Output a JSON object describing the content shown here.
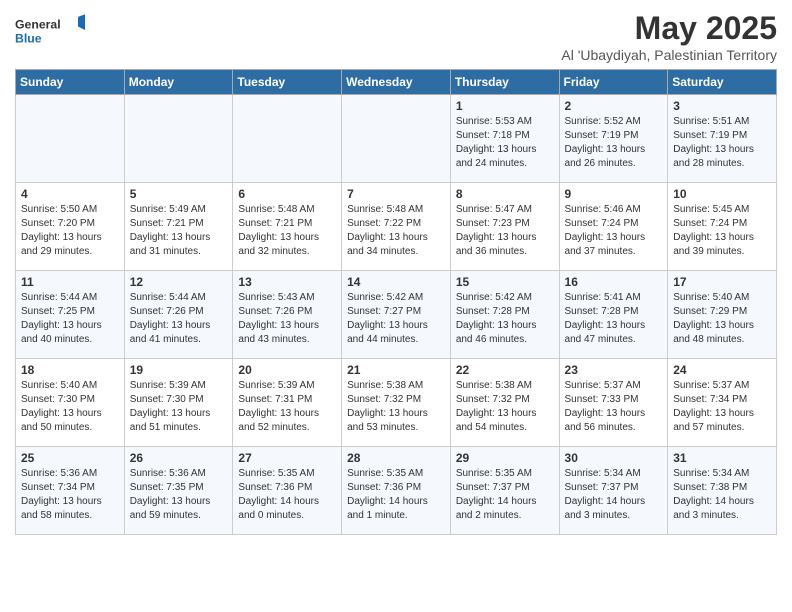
{
  "logo": {
    "text_general": "General",
    "text_blue": "Blue"
  },
  "title": "May 2025",
  "subtitle": "Al 'Ubaydiyah, Palestinian Territory",
  "weekdays": [
    "Sunday",
    "Monday",
    "Tuesday",
    "Wednesday",
    "Thursday",
    "Friday",
    "Saturday"
  ],
  "weeks": [
    [
      {
        "day": "",
        "info": ""
      },
      {
        "day": "",
        "info": ""
      },
      {
        "day": "",
        "info": ""
      },
      {
        "day": "",
        "info": ""
      },
      {
        "day": "1",
        "info": "Sunrise: 5:53 AM\nSunset: 7:18 PM\nDaylight: 13 hours\nand 24 minutes."
      },
      {
        "day": "2",
        "info": "Sunrise: 5:52 AM\nSunset: 7:19 PM\nDaylight: 13 hours\nand 26 minutes."
      },
      {
        "day": "3",
        "info": "Sunrise: 5:51 AM\nSunset: 7:19 PM\nDaylight: 13 hours\nand 28 minutes."
      }
    ],
    [
      {
        "day": "4",
        "info": "Sunrise: 5:50 AM\nSunset: 7:20 PM\nDaylight: 13 hours\nand 29 minutes."
      },
      {
        "day": "5",
        "info": "Sunrise: 5:49 AM\nSunset: 7:21 PM\nDaylight: 13 hours\nand 31 minutes."
      },
      {
        "day": "6",
        "info": "Sunrise: 5:48 AM\nSunset: 7:21 PM\nDaylight: 13 hours\nand 32 minutes."
      },
      {
        "day": "7",
        "info": "Sunrise: 5:48 AM\nSunset: 7:22 PM\nDaylight: 13 hours\nand 34 minutes."
      },
      {
        "day": "8",
        "info": "Sunrise: 5:47 AM\nSunset: 7:23 PM\nDaylight: 13 hours\nand 36 minutes."
      },
      {
        "day": "9",
        "info": "Sunrise: 5:46 AM\nSunset: 7:24 PM\nDaylight: 13 hours\nand 37 minutes."
      },
      {
        "day": "10",
        "info": "Sunrise: 5:45 AM\nSunset: 7:24 PM\nDaylight: 13 hours\nand 39 minutes."
      }
    ],
    [
      {
        "day": "11",
        "info": "Sunrise: 5:44 AM\nSunset: 7:25 PM\nDaylight: 13 hours\nand 40 minutes."
      },
      {
        "day": "12",
        "info": "Sunrise: 5:44 AM\nSunset: 7:26 PM\nDaylight: 13 hours\nand 41 minutes."
      },
      {
        "day": "13",
        "info": "Sunrise: 5:43 AM\nSunset: 7:26 PM\nDaylight: 13 hours\nand 43 minutes."
      },
      {
        "day": "14",
        "info": "Sunrise: 5:42 AM\nSunset: 7:27 PM\nDaylight: 13 hours\nand 44 minutes."
      },
      {
        "day": "15",
        "info": "Sunrise: 5:42 AM\nSunset: 7:28 PM\nDaylight: 13 hours\nand 46 minutes."
      },
      {
        "day": "16",
        "info": "Sunrise: 5:41 AM\nSunset: 7:28 PM\nDaylight: 13 hours\nand 47 minutes."
      },
      {
        "day": "17",
        "info": "Sunrise: 5:40 AM\nSunset: 7:29 PM\nDaylight: 13 hours\nand 48 minutes."
      }
    ],
    [
      {
        "day": "18",
        "info": "Sunrise: 5:40 AM\nSunset: 7:30 PM\nDaylight: 13 hours\nand 50 minutes."
      },
      {
        "day": "19",
        "info": "Sunrise: 5:39 AM\nSunset: 7:30 PM\nDaylight: 13 hours\nand 51 minutes."
      },
      {
        "day": "20",
        "info": "Sunrise: 5:39 AM\nSunset: 7:31 PM\nDaylight: 13 hours\nand 52 minutes."
      },
      {
        "day": "21",
        "info": "Sunrise: 5:38 AM\nSunset: 7:32 PM\nDaylight: 13 hours\nand 53 minutes."
      },
      {
        "day": "22",
        "info": "Sunrise: 5:38 AM\nSunset: 7:32 PM\nDaylight: 13 hours\nand 54 minutes."
      },
      {
        "day": "23",
        "info": "Sunrise: 5:37 AM\nSunset: 7:33 PM\nDaylight: 13 hours\nand 56 minutes."
      },
      {
        "day": "24",
        "info": "Sunrise: 5:37 AM\nSunset: 7:34 PM\nDaylight: 13 hours\nand 57 minutes."
      }
    ],
    [
      {
        "day": "25",
        "info": "Sunrise: 5:36 AM\nSunset: 7:34 PM\nDaylight: 13 hours\nand 58 minutes."
      },
      {
        "day": "26",
        "info": "Sunrise: 5:36 AM\nSunset: 7:35 PM\nDaylight: 13 hours\nand 59 minutes."
      },
      {
        "day": "27",
        "info": "Sunrise: 5:35 AM\nSunset: 7:36 PM\nDaylight: 14 hours\nand 0 minutes."
      },
      {
        "day": "28",
        "info": "Sunrise: 5:35 AM\nSunset: 7:36 PM\nDaylight: 14 hours\nand 1 minute."
      },
      {
        "day": "29",
        "info": "Sunrise: 5:35 AM\nSunset: 7:37 PM\nDaylight: 14 hours\nand 2 minutes."
      },
      {
        "day": "30",
        "info": "Sunrise: 5:34 AM\nSunset: 7:37 PM\nDaylight: 14 hours\nand 3 minutes."
      },
      {
        "day": "31",
        "info": "Sunrise: 5:34 AM\nSunset: 7:38 PM\nDaylight: 14 hours\nand 3 minutes."
      }
    ]
  ]
}
